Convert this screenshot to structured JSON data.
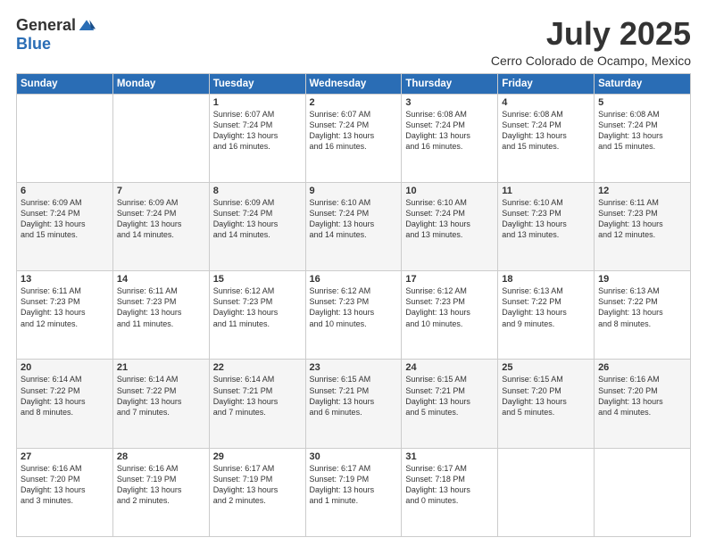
{
  "logo": {
    "general": "General",
    "blue": "Blue"
  },
  "title": "July 2025",
  "location": "Cerro Colorado de Ocampo, Mexico",
  "headers": [
    "Sunday",
    "Monday",
    "Tuesday",
    "Wednesday",
    "Thursday",
    "Friday",
    "Saturday"
  ],
  "weeks": [
    [
      {
        "day": "",
        "info": ""
      },
      {
        "day": "",
        "info": ""
      },
      {
        "day": "1",
        "info": "Sunrise: 6:07 AM\nSunset: 7:24 PM\nDaylight: 13 hours\nand 16 minutes."
      },
      {
        "day": "2",
        "info": "Sunrise: 6:07 AM\nSunset: 7:24 PM\nDaylight: 13 hours\nand 16 minutes."
      },
      {
        "day": "3",
        "info": "Sunrise: 6:08 AM\nSunset: 7:24 PM\nDaylight: 13 hours\nand 16 minutes."
      },
      {
        "day": "4",
        "info": "Sunrise: 6:08 AM\nSunset: 7:24 PM\nDaylight: 13 hours\nand 15 minutes."
      },
      {
        "day": "5",
        "info": "Sunrise: 6:08 AM\nSunset: 7:24 PM\nDaylight: 13 hours\nand 15 minutes."
      }
    ],
    [
      {
        "day": "6",
        "info": "Sunrise: 6:09 AM\nSunset: 7:24 PM\nDaylight: 13 hours\nand 15 minutes."
      },
      {
        "day": "7",
        "info": "Sunrise: 6:09 AM\nSunset: 7:24 PM\nDaylight: 13 hours\nand 14 minutes."
      },
      {
        "day": "8",
        "info": "Sunrise: 6:09 AM\nSunset: 7:24 PM\nDaylight: 13 hours\nand 14 minutes."
      },
      {
        "day": "9",
        "info": "Sunrise: 6:10 AM\nSunset: 7:24 PM\nDaylight: 13 hours\nand 14 minutes."
      },
      {
        "day": "10",
        "info": "Sunrise: 6:10 AM\nSunset: 7:24 PM\nDaylight: 13 hours\nand 13 minutes."
      },
      {
        "day": "11",
        "info": "Sunrise: 6:10 AM\nSunset: 7:23 PM\nDaylight: 13 hours\nand 13 minutes."
      },
      {
        "day": "12",
        "info": "Sunrise: 6:11 AM\nSunset: 7:23 PM\nDaylight: 13 hours\nand 12 minutes."
      }
    ],
    [
      {
        "day": "13",
        "info": "Sunrise: 6:11 AM\nSunset: 7:23 PM\nDaylight: 13 hours\nand 12 minutes."
      },
      {
        "day": "14",
        "info": "Sunrise: 6:11 AM\nSunset: 7:23 PM\nDaylight: 13 hours\nand 11 minutes."
      },
      {
        "day": "15",
        "info": "Sunrise: 6:12 AM\nSunset: 7:23 PM\nDaylight: 13 hours\nand 11 minutes."
      },
      {
        "day": "16",
        "info": "Sunrise: 6:12 AM\nSunset: 7:23 PM\nDaylight: 13 hours\nand 10 minutes."
      },
      {
        "day": "17",
        "info": "Sunrise: 6:12 AM\nSunset: 7:23 PM\nDaylight: 13 hours\nand 10 minutes."
      },
      {
        "day": "18",
        "info": "Sunrise: 6:13 AM\nSunset: 7:22 PM\nDaylight: 13 hours\nand 9 minutes."
      },
      {
        "day": "19",
        "info": "Sunrise: 6:13 AM\nSunset: 7:22 PM\nDaylight: 13 hours\nand 8 minutes."
      }
    ],
    [
      {
        "day": "20",
        "info": "Sunrise: 6:14 AM\nSunset: 7:22 PM\nDaylight: 13 hours\nand 8 minutes."
      },
      {
        "day": "21",
        "info": "Sunrise: 6:14 AM\nSunset: 7:22 PM\nDaylight: 13 hours\nand 7 minutes."
      },
      {
        "day": "22",
        "info": "Sunrise: 6:14 AM\nSunset: 7:21 PM\nDaylight: 13 hours\nand 7 minutes."
      },
      {
        "day": "23",
        "info": "Sunrise: 6:15 AM\nSunset: 7:21 PM\nDaylight: 13 hours\nand 6 minutes."
      },
      {
        "day": "24",
        "info": "Sunrise: 6:15 AM\nSunset: 7:21 PM\nDaylight: 13 hours\nand 5 minutes."
      },
      {
        "day": "25",
        "info": "Sunrise: 6:15 AM\nSunset: 7:20 PM\nDaylight: 13 hours\nand 5 minutes."
      },
      {
        "day": "26",
        "info": "Sunrise: 6:16 AM\nSunset: 7:20 PM\nDaylight: 13 hours\nand 4 minutes."
      }
    ],
    [
      {
        "day": "27",
        "info": "Sunrise: 6:16 AM\nSunset: 7:20 PM\nDaylight: 13 hours\nand 3 minutes."
      },
      {
        "day": "28",
        "info": "Sunrise: 6:16 AM\nSunset: 7:19 PM\nDaylight: 13 hours\nand 2 minutes."
      },
      {
        "day": "29",
        "info": "Sunrise: 6:17 AM\nSunset: 7:19 PM\nDaylight: 13 hours\nand 2 minutes."
      },
      {
        "day": "30",
        "info": "Sunrise: 6:17 AM\nSunset: 7:19 PM\nDaylight: 13 hours\nand 1 minute."
      },
      {
        "day": "31",
        "info": "Sunrise: 6:17 AM\nSunset: 7:18 PM\nDaylight: 13 hours\nand 0 minutes."
      },
      {
        "day": "",
        "info": ""
      },
      {
        "day": "",
        "info": ""
      }
    ]
  ]
}
